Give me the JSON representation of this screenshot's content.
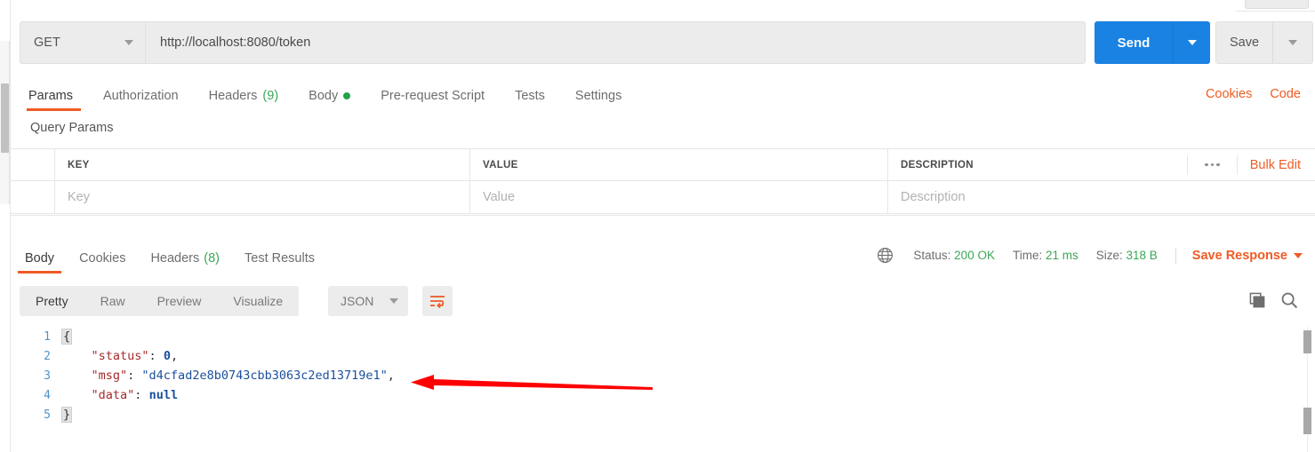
{
  "request": {
    "method": "GET",
    "method_caret_icon": "chevron-down-icon",
    "url": "http://localhost:8080/token",
    "send_label": "Send",
    "send_caret_icon": "chevron-down-icon",
    "save_label": "Save",
    "save_caret_icon": "chevron-down-icon",
    "tabs": [
      {
        "label": "Params",
        "count": "",
        "dot": false,
        "active": true
      },
      {
        "label": "Authorization",
        "count": "",
        "dot": false,
        "active": false
      },
      {
        "label": "Headers",
        "count": "(9)",
        "dot": false,
        "active": false
      },
      {
        "label": "Body",
        "count": "",
        "dot": true,
        "active": false
      },
      {
        "label": "Pre-request Script",
        "count": "",
        "dot": false,
        "active": false
      },
      {
        "label": "Tests",
        "count": "",
        "dot": false,
        "active": false
      },
      {
        "label": "Settings",
        "count": "",
        "dot": false,
        "active": false
      }
    ],
    "links": [
      {
        "label": "Cookies"
      },
      {
        "label": "Code"
      }
    ]
  },
  "query_params": {
    "title": "Query Params",
    "columns": [
      "KEY",
      "VALUE",
      "DESCRIPTION"
    ],
    "rows": [
      {
        "key": "Key",
        "value": "Value",
        "description": "Description"
      }
    ],
    "more_icon": "ellipsis-icon",
    "bulk_edit_label": "Bulk Edit"
  },
  "response": {
    "tabs": [
      {
        "label": "Body",
        "count": "",
        "active": true
      },
      {
        "label": "Cookies",
        "count": "",
        "active": false
      },
      {
        "label": "Headers",
        "count": "(8)",
        "active": false
      },
      {
        "label": "Test Results",
        "count": "",
        "active": false
      }
    ],
    "globe_icon": "globe-icon",
    "status_label": "Status:",
    "status_value": "200 OK",
    "time_label": "Time:",
    "time_value": "21 ms",
    "size_label": "Size:",
    "size_value": "318 B",
    "save_response_label": "Save Response",
    "save_response_caret_icon": "chevron-down-icon",
    "format_tabs": [
      {
        "label": "Pretty",
        "active": true
      },
      {
        "label": "Raw",
        "active": false
      },
      {
        "label": "Preview",
        "active": false
      },
      {
        "label": "Visualize",
        "active": false
      }
    ],
    "content_type": "JSON",
    "content_type_caret_icon": "chevron-down-icon",
    "wrap_lines_icon": "wrap-text-icon",
    "copy_icon": "copy-icon",
    "search_icon": "search-icon"
  },
  "body": {
    "lines": [
      {
        "n": "1",
        "indent": 0,
        "parts": [
          {
            "t": "brace",
            "v": "{"
          }
        ]
      },
      {
        "n": "2",
        "indent": 4,
        "parts": [
          {
            "t": "key",
            "v": "\"status\""
          },
          {
            "t": "punc",
            "v": ": "
          },
          {
            "t": "num",
            "v": "0"
          },
          {
            "t": "punc",
            "v": ","
          }
        ]
      },
      {
        "n": "3",
        "indent": 4,
        "parts": [
          {
            "t": "key",
            "v": "\"msg\""
          },
          {
            "t": "punc",
            "v": ": "
          },
          {
            "t": "str",
            "v": "\"d4cfad2e8b0743cbb3063c2ed13719e1\""
          },
          {
            "t": "punc",
            "v": ","
          }
        ]
      },
      {
        "n": "4",
        "indent": 4,
        "parts": [
          {
            "t": "key",
            "v": "\"data\""
          },
          {
            "t": "punc",
            "v": ": "
          },
          {
            "t": "null",
            "v": "null"
          }
        ]
      },
      {
        "n": "5",
        "indent": 0,
        "parts": [
          {
            "t": "brace",
            "v": "}"
          }
        ]
      }
    ],
    "json_values": {
      "status": 0,
      "msg": "d4cfad2e8b0743cbb3063c2ed13719e1",
      "data": null
    }
  },
  "annotation": {
    "arrow_color": "#ff0000",
    "arrow_direction": "left"
  },
  "colors": {
    "accent": "#ef5b25",
    "send_blue": "#1a82e2",
    "success_green": "#3aa757",
    "chrome_gray": "#ececec"
  }
}
